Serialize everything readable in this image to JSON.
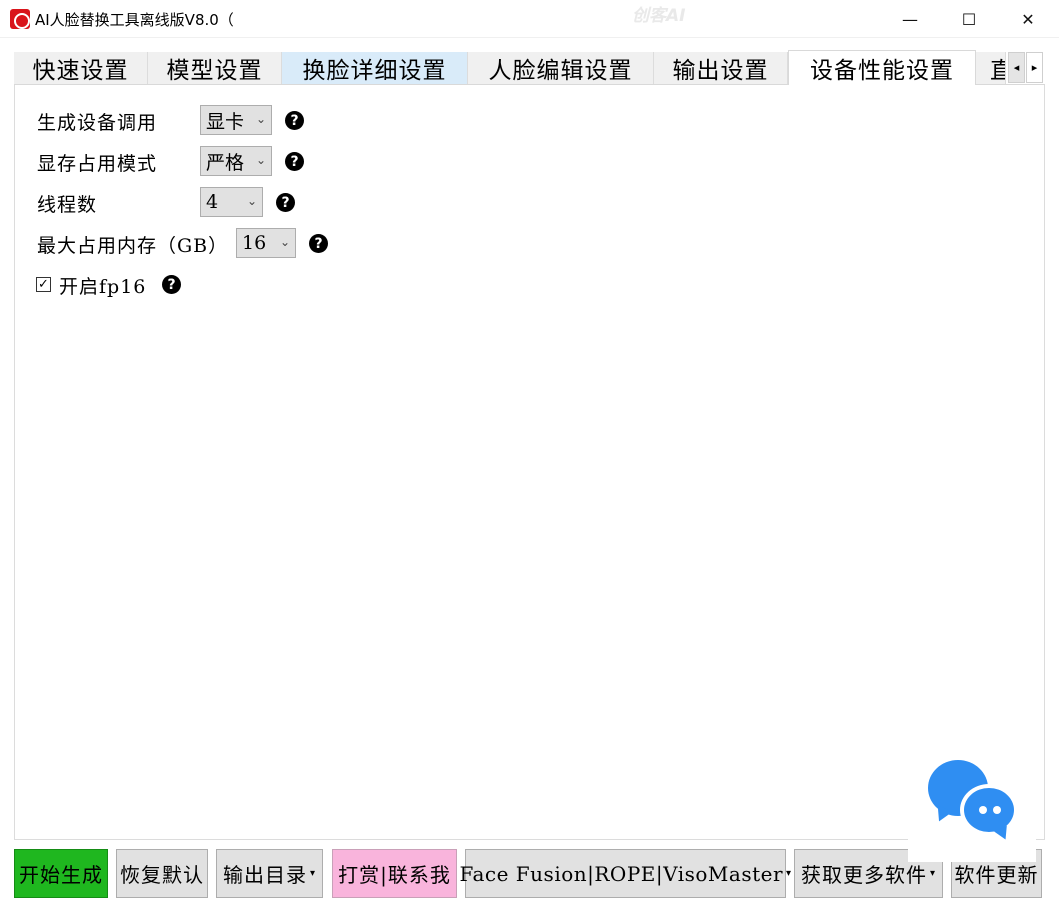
{
  "window": {
    "title": "AI人脸替换工具离线版V8.0（",
    "watermark": "创客AI",
    "minimize_glyph": "—",
    "maximize_glyph": "☐",
    "close_glyph": "✕"
  },
  "tabs": [
    {
      "label": "快速设置"
    },
    {
      "label": "模型设置"
    },
    {
      "label": "换脸详细设置"
    },
    {
      "label": "人脸编辑设置"
    },
    {
      "label": "输出设置"
    },
    {
      "label": "设备性能设置"
    },
    {
      "label": "直"
    }
  ],
  "tab_scroll": {
    "left": "◂",
    "right": "▸"
  },
  "settings": {
    "device": {
      "label": "生成设备调用",
      "value": "显卡"
    },
    "vram_mode": {
      "label": "显存占用模式",
      "value": "严格"
    },
    "threads": {
      "label": "线程数",
      "value": "4"
    },
    "max_memory": {
      "label": "最大占用内存（GB）",
      "value": "16"
    },
    "fp16": {
      "label": "开启fp16",
      "checked": true,
      "mark": "✓"
    },
    "help_glyph": "?",
    "arrow_glyph": "⌄"
  },
  "toolbar": {
    "start": "开始生成",
    "restore_default": "恢复默认",
    "output_dir": "输出目录",
    "donate_contact": "打赏|联系我",
    "face_fusion": "Face Fusion|ROPE|VisoMaster",
    "more_software": "获取更多软件",
    "update": "软件更新",
    "caret": "▾"
  },
  "colors": {
    "start_button": "#1fb71f",
    "donate_button": "#f9b4dc",
    "tab_hover": "#d9ebf9",
    "chat_blue": "#2f8ef2"
  }
}
